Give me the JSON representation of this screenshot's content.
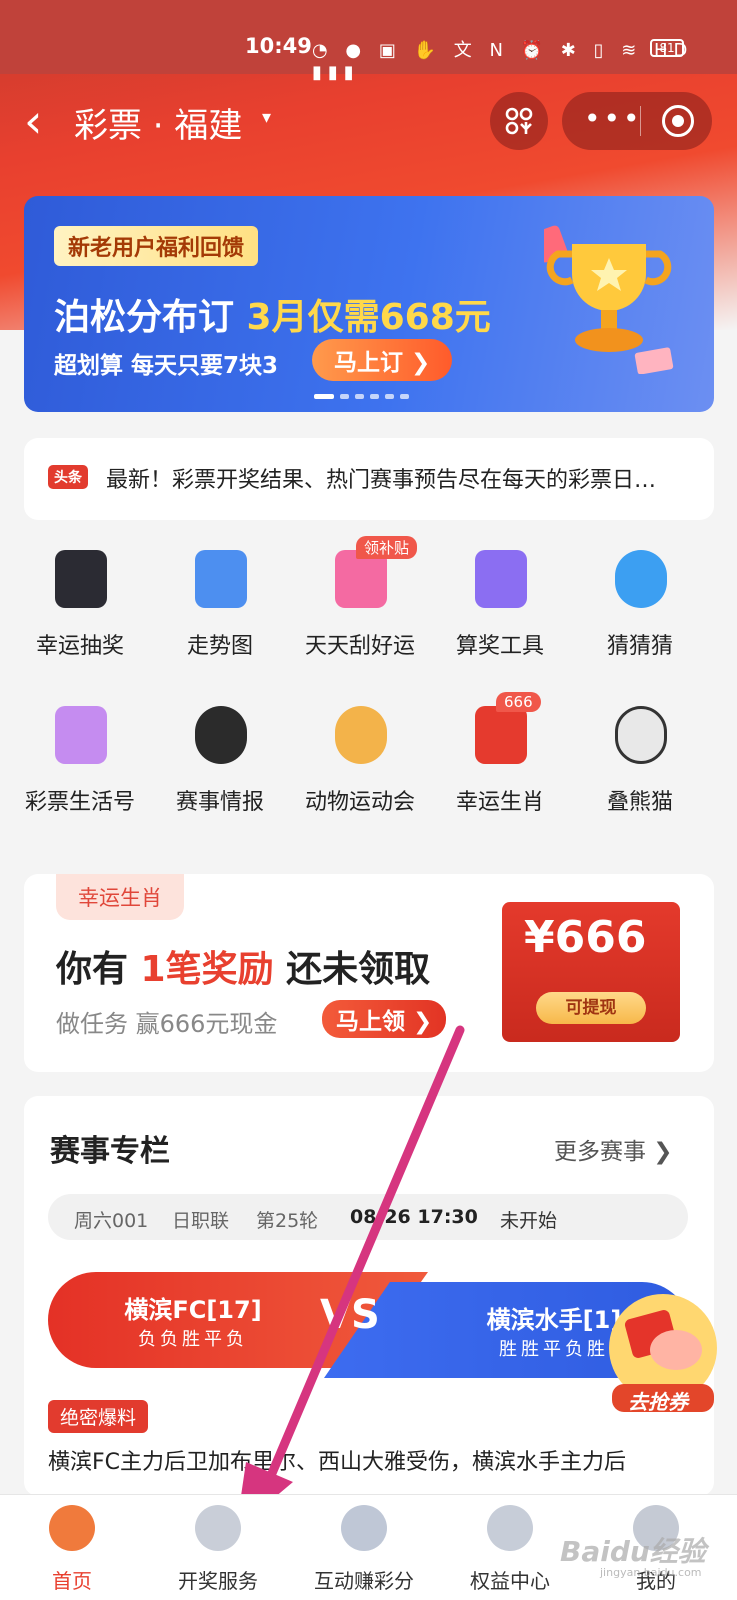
{
  "status_bar": {
    "time": "10:49",
    "icons": "◔ ● ▣ ✋ 文 N ⏰ ✱ ▯ ≋ HD ▮▮▮",
    "battery": "81"
  },
  "header": {
    "title": "彩票 · 福建",
    "caret": "▾",
    "back_icon": "chevron-left-icon"
  },
  "banner": {
    "tag": "新老用户福利回馈",
    "main_prefix": "泊松分布订 ",
    "main_highlight": "3月仅需668元",
    "sub": "超划算 每天只要7块3",
    "cta": "马上订 ❯"
  },
  "news": {
    "badge": "头条",
    "text": "最新！彩票开奖结果、热门赛事预告尽在每天的彩票日…"
  },
  "grid": [
    {
      "label": "幸运抽奖",
      "icon": "phone-icon",
      "color": "#2b2b33",
      "badge": ""
    },
    {
      "label": "走势图",
      "icon": "chart-icon",
      "color": "#4d8ff0",
      "badge": ""
    },
    {
      "label": "天天刮好运",
      "icon": "ticket-icon",
      "color": "#f46aa2",
      "badge": "领补贴"
    },
    {
      "label": "算奖工具",
      "icon": "calculator-icon",
      "color": "#8b6ef2",
      "badge": ""
    },
    {
      "label": "猜猜猜",
      "icon": "question-icon",
      "color": "#3c9ff2",
      "badge": ""
    },
    {
      "label": "彩票生活号",
      "icon": "heart-icon",
      "color": "#c58cf0",
      "badge": ""
    },
    {
      "label": "赛事情报",
      "icon": "soccer-ball-icon",
      "color": "#2b2b2b",
      "badge": ""
    },
    {
      "label": "动物运动会",
      "icon": "medal-icon",
      "color": "#f3b34a",
      "badge": ""
    },
    {
      "label": "幸运生肖",
      "icon": "red-card-icon",
      "color": "#e53a2e",
      "badge": "666"
    },
    {
      "label": "叠熊猫",
      "icon": "panda-icon",
      "color": "#e8e8e8",
      "badge": ""
    }
  ],
  "reward": {
    "tag": "幸运生肖",
    "title_a": "你有 ",
    "title_hl": "1笔奖励",
    "title_b": " 还未领取",
    "sub": "做任务 赢666元现金",
    "cta": "马上领 ❯",
    "amount": "¥666",
    "withdraw": "可提现"
  },
  "match": {
    "title": "赛事专栏",
    "more": "更多赛事  ❯",
    "info": {
      "no": "周六001",
      "league": "日职联",
      "round": "第25轮",
      "time": "08-26 17:30",
      "state": "未开始"
    },
    "home": {
      "name": "横滨FC[17]",
      "form": "负负胜平负"
    },
    "away": {
      "name": "横滨水手[1]",
      "form": "胜胜平负胜"
    },
    "vs": "VS",
    "exclusive_tag": "绝密爆料",
    "exclusive_text": "横滨FC主力后卫加布里尔、西山大雅受伤，横滨水手主力后"
  },
  "coupon": {
    "label": "去抢券"
  },
  "tabbar": [
    {
      "label": "首页",
      "icon": "home-icon",
      "active": true
    },
    {
      "label": "开奖服务",
      "icon": "lottery-ball-icon",
      "active": false
    },
    {
      "label": "互动赚彩分",
      "icon": "planet-icon",
      "active": false
    },
    {
      "label": "权益中心",
      "icon": "clover-icon",
      "active": false
    },
    {
      "label": "我的",
      "icon": "user-icon",
      "active": false
    }
  ],
  "watermark": {
    "text": "Baidu经验",
    "sub": "jingyan.baidu.com"
  },
  "colors": {
    "brand_red": "#e8402f",
    "banner_blue": "#3e73ef",
    "annotation_arrow": "#d63384"
  }
}
